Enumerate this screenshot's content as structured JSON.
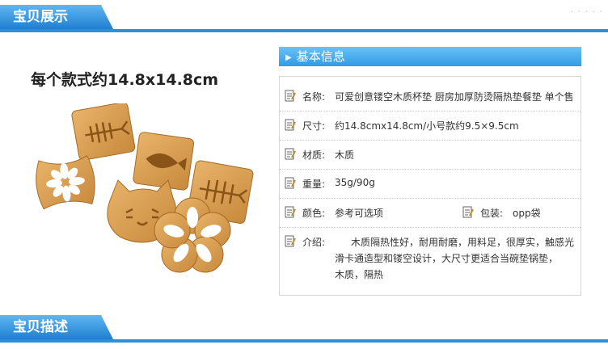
{
  "header_top": {
    "title": "宝贝展示"
  },
  "header_bottom": {
    "title": "宝贝描述"
  },
  "caption": "每个款式约14.8x14.8cm",
  "info": {
    "title": "基本信息",
    "name_label": "名称:",
    "name_value": "可爱创意镂空木质杯垫 厨房加厚防烫隔热垫餐垫 单个售",
    "size_label": "尺寸:",
    "size_value": "约14.8cmx14.8cm/小号款约9.5×9.5cm",
    "material_label": "材质:",
    "material_value": "木质",
    "weight_label": "重量:",
    "weight_value": "35g/90g",
    "color_label": "颜色:",
    "color_value": "参考可选项",
    "pack_label": "包装:",
    "pack_value": "opp袋",
    "intro_label": "介绍:",
    "intro_lines": [
      "木质隔热性好，耐用耐磨，用料足，很厚实，触感光",
      "滑卡通造型和镂空设计，大尺寸更适合当碗垫锅垫，",
      "木质，隔热"
    ]
  },
  "colors": {
    "accent": "#2f8fd8",
    "wood": "#d9a055",
    "wood_dark": "#a86a25"
  }
}
